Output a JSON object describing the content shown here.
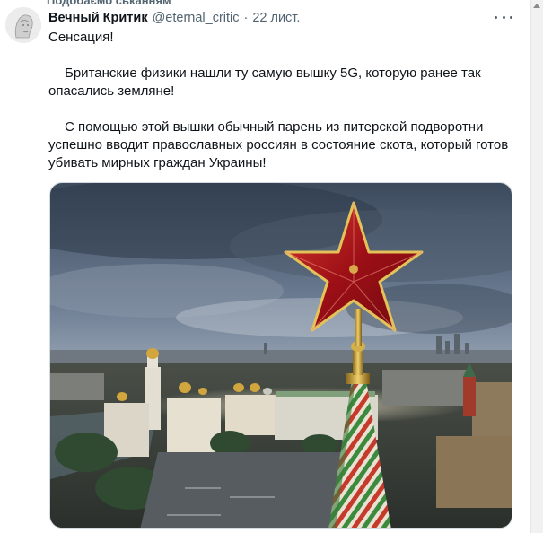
{
  "context_line": "Подобаємо ськанням",
  "tweet": {
    "display_name": "Вечный Критик",
    "handle": "@eternal_critic",
    "separator": "·",
    "date": "22 лист.",
    "lines": [
      "Сенсация!",
      "Британские физики нашли ту самую вышку 5G, которую ранее так",
      "опасались земляне!",
      "С помощью этой вышки обычный парень из питерской подворотни",
      "успешно вводит православных россиян в состояние скота, который готов",
      "убивать мирных граждан Украины!"
    ]
  },
  "icons": {
    "more": "more-horizontal-icon",
    "avatar": "avatar-image"
  },
  "colors": {
    "text": "#0f1419",
    "secondary": "#536471",
    "star": "#b3121b"
  }
}
